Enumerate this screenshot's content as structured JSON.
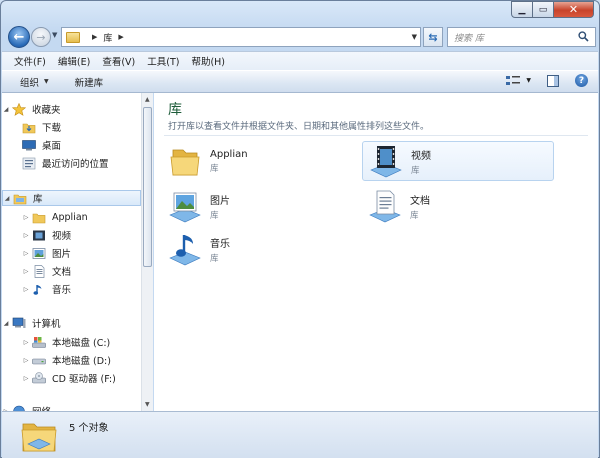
{
  "address": {
    "crumb": "库"
  },
  "search": {
    "placeholder": "搜索 库"
  },
  "menu": [
    "文件(F)",
    "编辑(E)",
    "查看(V)",
    "工具(T)",
    "帮助(H)"
  ],
  "toolbar": {
    "organize": "组织",
    "new_library": "新建库"
  },
  "nav": {
    "favorites": "收藏夹",
    "downloads": "下载",
    "desktop": "桌面",
    "recent": "最近访问的位置",
    "libraries": "库",
    "lib_items": [
      "Applian",
      "视频",
      "图片",
      "文档",
      "音乐"
    ],
    "computer": "计算机",
    "drives": [
      "本地磁盘 (C:)",
      "本地磁盘 (D:)",
      "CD 驱动器 (F:)"
    ],
    "network": "网络"
  },
  "content": {
    "title": "库",
    "description": "打开库以查看文件并根据文件夹、日期和其他属性排列这些文件。",
    "tiles": [
      {
        "name": "Applian",
        "type": "库",
        "icon": "folder-icon"
      },
      {
        "name": "视频",
        "type": "库",
        "icon": "video-library-icon"
      },
      {
        "name": "图片",
        "type": "库",
        "icon": "pictures-library-icon"
      },
      {
        "name": "文档",
        "type": "库",
        "icon": "documents-library-icon"
      },
      {
        "name": "音乐",
        "type": "库",
        "icon": "music-library-icon"
      }
    ]
  },
  "status": {
    "count_text": "5 个对象"
  },
  "colors": {
    "accent": "#2a6bb8",
    "title_green": "#1e5c3a",
    "folder_yellow": "#f0c85a"
  }
}
